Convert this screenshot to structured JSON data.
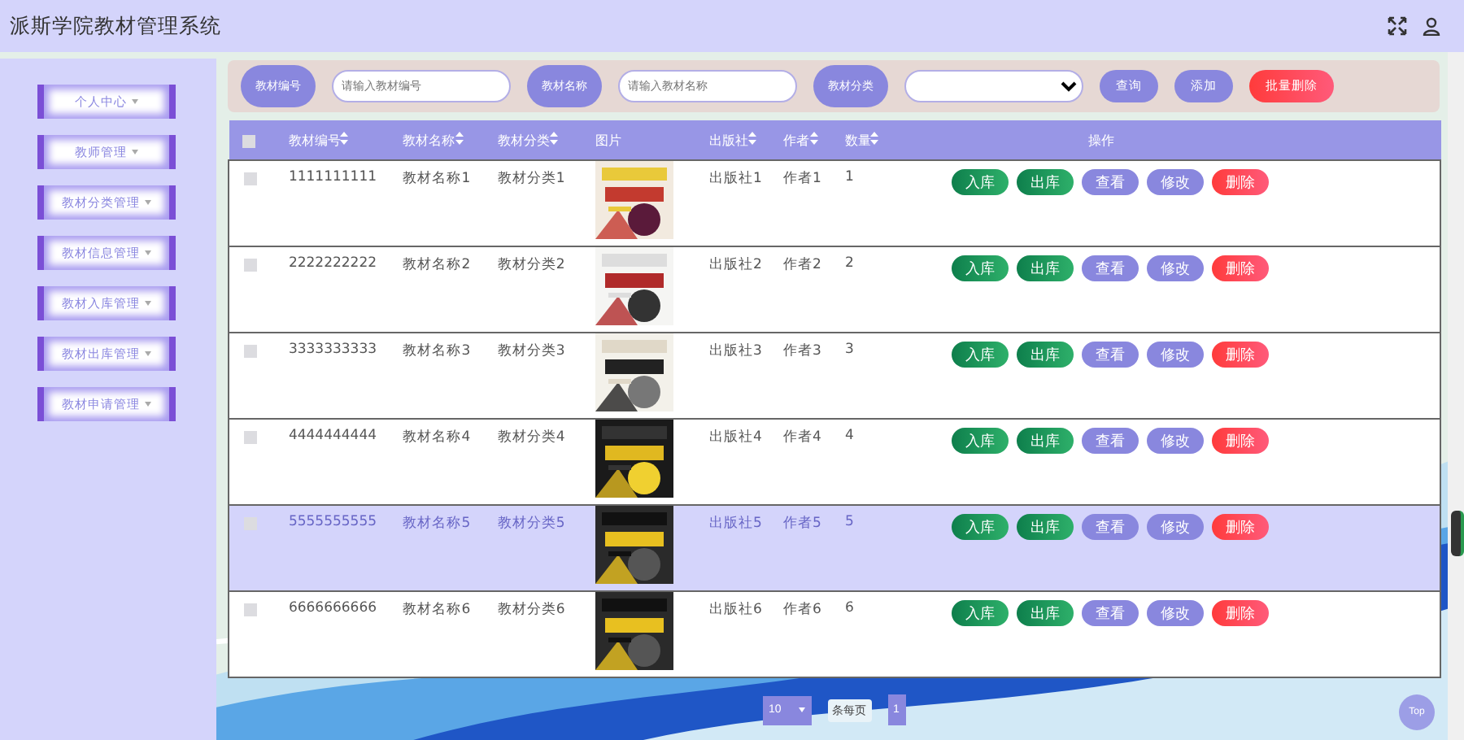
{
  "app": {
    "title": "派斯学院教材管理系统"
  },
  "sidebar": {
    "items": [
      {
        "label": "个人中心"
      },
      {
        "label": "教师管理"
      },
      {
        "label": "教材分类管理"
      },
      {
        "label": "教材信息管理"
      },
      {
        "label": "教材入库管理"
      },
      {
        "label": "教材出库管理"
      },
      {
        "label": "教材申请管理"
      }
    ]
  },
  "search": {
    "fields": [
      {
        "label": "教材编号",
        "kind": "text",
        "placeholder": "请输入教材编号"
      },
      {
        "label": "教材名称",
        "kind": "text",
        "placeholder": "请输入教材名称"
      },
      {
        "label": "教材分类",
        "kind": "select"
      }
    ],
    "buttons": [
      {
        "label": "查询",
        "kind": "primary"
      },
      {
        "label": "添加",
        "kind": "primary"
      },
      {
        "label": "批量删除",
        "kind": "danger"
      }
    ]
  },
  "table": {
    "select_all": {
      "checked": false
    },
    "columns": [
      {
        "label": "教材编号",
        "sortable": true
      },
      {
        "label": "教材名称",
        "sortable": true
      },
      {
        "label": "教材分类",
        "sortable": true
      },
      {
        "label": "图片",
        "sortable": false,
        "kind": "picture"
      },
      {
        "label": "出版社",
        "sortable": true
      },
      {
        "label": "作者",
        "sortable": true
      },
      {
        "label": "数量",
        "sortable": true
      },
      {
        "label": "操作",
        "sortable": false
      }
    ],
    "rows": [
      {
        "checked": false,
        "highlighted": false,
        "cells": [
          "1111111111",
          "教材名称1",
          "教材分类1",
          "",
          "出版社1",
          "作者1",
          "1"
        ],
        "actions": [
          {
            "label": "入库",
            "kind": "green"
          },
          {
            "label": "出库",
            "kind": "green"
          },
          {
            "label": "查看",
            "kind": "primary"
          },
          {
            "label": "修改",
            "kind": "primary"
          },
          {
            "label": "删除",
            "kind": "danger"
          }
        ]
      },
      {
        "checked": false,
        "highlighted": false,
        "cells": [
          "2222222222",
          "教材名称2",
          "教材分类2",
          "",
          "出版社2",
          "作者2",
          "2"
        ],
        "actions": [
          {
            "label": "入库",
            "kind": "green"
          },
          {
            "label": "出库",
            "kind": "green"
          },
          {
            "label": "查看",
            "kind": "primary"
          },
          {
            "label": "修改",
            "kind": "primary"
          },
          {
            "label": "删除",
            "kind": "danger"
          }
        ]
      },
      {
        "checked": false,
        "highlighted": false,
        "cells": [
          "3333333333",
          "教材名称3",
          "教材分类3",
          "",
          "出版社3",
          "作者3",
          "3"
        ],
        "actions": [
          {
            "label": "入库",
            "kind": "green"
          },
          {
            "label": "出库",
            "kind": "green"
          },
          {
            "label": "查看",
            "kind": "primary"
          },
          {
            "label": "修改",
            "kind": "primary"
          },
          {
            "label": "删除",
            "kind": "danger"
          }
        ]
      },
      {
        "checked": false,
        "highlighted": false,
        "cells": [
          "4444444444",
          "教材名称4",
          "教材分类4",
          "",
          "出版社4",
          "作者4",
          "4"
        ],
        "actions": [
          {
            "label": "入库",
            "kind": "green"
          },
          {
            "label": "出库",
            "kind": "green"
          },
          {
            "label": "查看",
            "kind": "primary"
          },
          {
            "label": "修改",
            "kind": "primary"
          },
          {
            "label": "删除",
            "kind": "danger"
          }
        ]
      },
      {
        "checked": false,
        "highlighted": true,
        "cells": [
          "5555555555",
          "教材名称5",
          "教材分类5",
          "",
          "出版社5",
          "作者5",
          "5"
        ],
        "actions": [
          {
            "label": "入库",
            "kind": "green"
          },
          {
            "label": "出库",
            "kind": "green"
          },
          {
            "label": "查看",
            "kind": "primary"
          },
          {
            "label": "修改",
            "kind": "primary"
          },
          {
            "label": "删除",
            "kind": "danger"
          }
        ]
      },
      {
        "checked": false,
        "highlighted": false,
        "cells": [
          "6666666666",
          "教材名称6",
          "教材分类6",
          "",
          "出版社6",
          "作者6",
          "6"
        ],
        "actions": [
          {
            "label": "入库",
            "kind": "green"
          },
          {
            "label": "出库",
            "kind": "green"
          },
          {
            "label": "查看",
            "kind": "primary"
          },
          {
            "label": "修改",
            "kind": "primary"
          },
          {
            "label": "删除",
            "kind": "danger"
          }
        ]
      }
    ]
  },
  "pagination": {
    "page_size": "10",
    "per_page_label": "条每页",
    "pages": [
      {
        "label": "1",
        "selected": true
      }
    ]
  },
  "back_to_top": {
    "label": "Top"
  }
}
